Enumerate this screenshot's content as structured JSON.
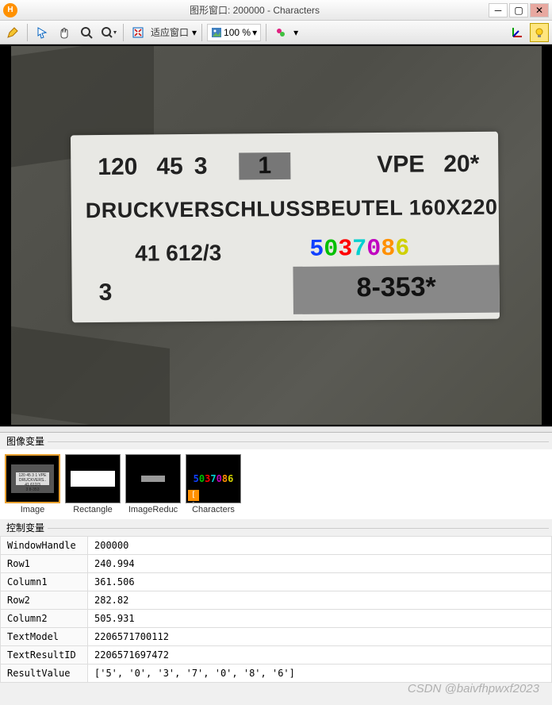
{
  "titlebar": {
    "title": "图形窗口: 200000 - Characters"
  },
  "toolbar": {
    "fit_label": "适应窗口",
    "zoom_label": "100 %"
  },
  "image_label": {
    "row1_a": "120",
    "row1_b": "45",
    "row1_c": "3",
    "row1_box": "1",
    "row1_d": "VPE",
    "row1_e": "20*",
    "row2": "DRUCKVERSCHLUSSBEUTEL 160X220",
    "row3": "41 612/3",
    "row4_left": "3",
    "row4_box": "8-353*",
    "ocr_chars": [
      "5",
      "0",
      "3",
      "7",
      "0",
      "8",
      "6"
    ]
  },
  "sections": {
    "image_vars": "图像变量",
    "control_vars": "控制变量"
  },
  "thumbs": [
    {
      "label": "Image"
    },
    {
      "label": "Rectangle"
    },
    {
      "label": "ImageReduc"
    },
    {
      "label": "Characters"
    }
  ],
  "vars": [
    {
      "name": "WindowHandle",
      "value": "200000"
    },
    {
      "name": "Row1",
      "value": "240.994"
    },
    {
      "name": "Column1",
      "value": "361.506"
    },
    {
      "name": "Row2",
      "value": "282.82"
    },
    {
      "name": "Column2",
      "value": "505.931"
    },
    {
      "name": "TextModel",
      "value": "2206571700112"
    },
    {
      "name": "TextResultID",
      "value": "2206571697472"
    },
    {
      "name": "ResultValue",
      "value": "['5', '0', '3', '7', '0', '8', '6']"
    }
  ],
  "watermark": "CSDN @baivfhpwxf2023"
}
